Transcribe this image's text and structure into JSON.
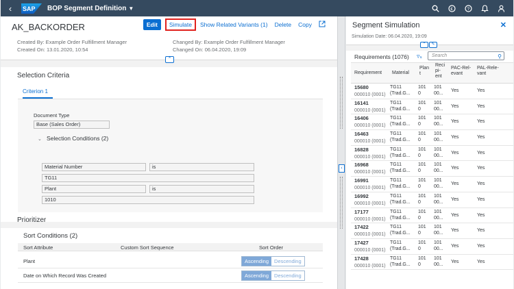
{
  "shell": {
    "logo": "SAP",
    "app_title": "BOP Segment Definition",
    "icons": [
      "search-icon",
      "coin-icon",
      "help-icon",
      "bell-icon",
      "user-icon"
    ]
  },
  "object": {
    "title": "AK_BACKORDER",
    "actions": {
      "edit": "Edit",
      "simulate": "Simulate",
      "show_related": "Show Related Variants (1)",
      "delete": "Delete",
      "copy": "Copy"
    },
    "created_by": "Created By: Example Order Fulfillment Manager",
    "created_on": "Created On: 13.01.2020, 10:54",
    "changed_by": "Changed By: Example Order Fulfillment Manager",
    "changed_on": "Changed On: 06.04.2020, 19:09"
  },
  "selection": {
    "title": "Selection Criteria",
    "tab": "Criterion 1",
    "doc_type_label": "Document Type",
    "doc_type_value": "Base (Sales Order)",
    "conditions_title": "Selection Conditions (2)",
    "conditions": [
      {
        "attribute": "Material Number",
        "operator": "is",
        "value": "TG11"
      },
      {
        "attribute": "Plant",
        "operator": "is",
        "value": "1010"
      }
    ]
  },
  "prioritizer": {
    "title": "Prioritizer",
    "sort_title": "Sort Conditions (2)",
    "columns": [
      "Sort Attribute",
      "Custom Sort Sequence",
      "Sort Order"
    ],
    "rows": [
      {
        "attribute": "Plant",
        "ascending": "Ascending",
        "descending": "Descending"
      },
      {
        "attribute": "Date on Which Record Was Created",
        "ascending": "Ascending",
        "descending": "Descending"
      }
    ]
  },
  "simulation": {
    "title": "Segment Simulation",
    "date": "Simulation Date: 06.04.2020, 19:09",
    "requirements_label": "Requirements (1076)",
    "search_placeholder": "Search",
    "columns": {
      "requirement": "Requirement",
      "material": "Material",
      "plant": [
        "Plan",
        "t"
      ],
      "recipient": [
        "Reci",
        "pi-",
        "ent"
      ],
      "pac": "PAC-Rel-evant",
      "pal": [
        "PAL-Rele-",
        "vant"
      ]
    },
    "rows": [
      {
        "req": "15680",
        "sub": "000010 (0001)",
        "mat": "TG11",
        "mat2": "(Trad.G...",
        "plant": "101",
        "plant2": "0",
        "rec": "101",
        "rec2": "00...",
        "pac": "Yes",
        "pal": "Yes"
      },
      {
        "req": "16141",
        "sub": "000010 (0001)",
        "mat": "TG11",
        "mat2": "(Trad.G...",
        "plant": "101",
        "plant2": "0",
        "rec": "101",
        "rec2": "00...",
        "pac": "Yes",
        "pal": "Yes"
      },
      {
        "req": "16406",
        "sub": "000010 (0001)",
        "mat": "TG11",
        "mat2": "(Trad.G...",
        "plant": "101",
        "plant2": "0",
        "rec": "101",
        "rec2": "00...",
        "pac": "Yes",
        "pal": "Yes"
      },
      {
        "req": "16463",
        "sub": "000010 (0001)",
        "mat": "TG11",
        "mat2": "(Trad.G...",
        "plant": "101",
        "plant2": "0",
        "rec": "101",
        "rec2": "00...",
        "pac": "Yes",
        "pal": "Yes"
      },
      {
        "req": "16828",
        "sub": "000010 (0001)",
        "mat": "TG11",
        "mat2": "(Trad.G...",
        "plant": "101",
        "plant2": "0",
        "rec": "101",
        "rec2": "00...",
        "pac": "Yes",
        "pal": "Yes"
      },
      {
        "req": "16968",
        "sub": "000010 (0001)",
        "mat": "TG11",
        "mat2": "(Trad.G...",
        "plant": "101",
        "plant2": "0",
        "rec": "101",
        "rec2": "00...",
        "pac": "Yes",
        "pal": "Yes"
      },
      {
        "req": "16991",
        "sub": "000010 (0001)",
        "mat": "TG11",
        "mat2": "(Trad.G...",
        "plant": "101",
        "plant2": "0",
        "rec": "101",
        "rec2": "00...",
        "pac": "Yes",
        "pal": "Yes"
      },
      {
        "req": "16992",
        "sub": "000010 (0001)",
        "mat": "TG11",
        "mat2": "(Trad.G...",
        "plant": "101",
        "plant2": "0",
        "rec": "101",
        "rec2": "00...",
        "pac": "Yes",
        "pal": "Yes"
      },
      {
        "req": "17177",
        "sub": "000010 (0001)",
        "mat": "TG11",
        "mat2": "(Trad.G...",
        "plant": "101",
        "plant2": "0",
        "rec": "101",
        "rec2": "00...",
        "pac": "Yes",
        "pal": "Yes"
      },
      {
        "req": "17422",
        "sub": "000010 (0001)",
        "mat": "TG11",
        "mat2": "(Trad.G...",
        "plant": "101",
        "plant2": "0",
        "rec": "101",
        "rec2": "00...",
        "pac": "Yes",
        "pal": "Yes"
      },
      {
        "req": "17427",
        "sub": "000010 (0001)",
        "mat": "TG11",
        "mat2": "(Trad.G...",
        "plant": "101",
        "plant2": "0",
        "rec": "101",
        "rec2": "00...",
        "pac": "Yes",
        "pal": "Yes"
      },
      {
        "req": "17428",
        "sub": "000010 (0001)",
        "mat": "TG11",
        "mat2": "(Trad.G...",
        "plant": "101",
        "plant2": "0",
        "rec": "101",
        "rec2": "00...",
        "pac": "Yes",
        "pal": "Yes"
      }
    ]
  },
  "colors": {
    "shell": "#354a5f",
    "accent": "#0a6ed1",
    "highlight": "#e0201c"
  }
}
